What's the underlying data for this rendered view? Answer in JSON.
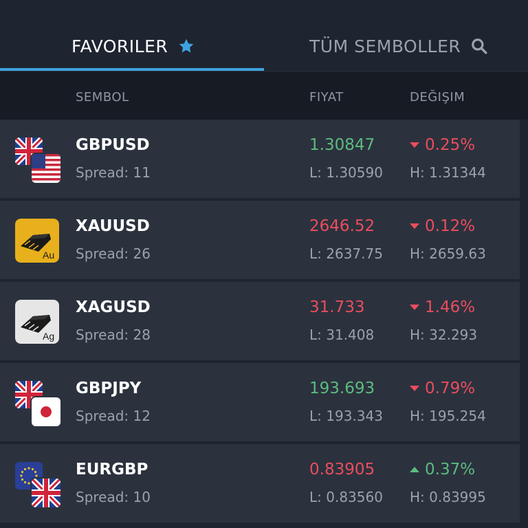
{
  "tabs": {
    "favorites_label": "FAVORILER",
    "all_symbols_label": "TÜM SEMBOLLER"
  },
  "columns": {
    "symbol": "SEMBOL",
    "price": "FIYAT",
    "change": "DEĞIŞIM"
  },
  "colors": {
    "accent": "#3ea3e0",
    "up": "#5dbb7f",
    "down": "#eb4d5d"
  },
  "rows": [
    {
      "symbol": "GBPUSD",
      "spread": "Spread: 11",
      "price": "1.30847",
      "price_dir": "up",
      "low": "L: 1.30590",
      "change": "0.25%",
      "change_dir": "down",
      "high": "H: 1.31344",
      "icon": "gbp-usd-flags-icon"
    },
    {
      "symbol": "XAUUSD",
      "spread": "Spread: 26",
      "price": "2646.52",
      "price_dir": "down",
      "low": "L: 2637.75",
      "change": "0.12%",
      "change_dir": "down",
      "high": "H: 2659.63",
      "icon": "gold-bar-icon",
      "metal_label": "Au"
    },
    {
      "symbol": "XAGUSD",
      "spread": "Spread: 28",
      "price": "31.733",
      "price_dir": "down",
      "low": "L: 31.408",
      "change": "1.46%",
      "change_dir": "down",
      "high": "H: 32.293",
      "icon": "silver-bar-icon",
      "metal_label": "Ag"
    },
    {
      "symbol": "GBPJPY",
      "spread": "Spread: 12",
      "price": "193.693",
      "price_dir": "up",
      "low": "L: 193.343",
      "change": "0.79%",
      "change_dir": "down",
      "high": "H: 195.254",
      "icon": "gbp-jpy-flags-icon"
    },
    {
      "symbol": "EURGBP",
      "spread": "Spread: 10",
      "price": "0.83905",
      "price_dir": "down",
      "low": "L: 0.83560",
      "change": "0.37%",
      "change_dir": "up",
      "high": "H: 0.83995",
      "icon": "eur-gbp-flags-icon"
    }
  ]
}
